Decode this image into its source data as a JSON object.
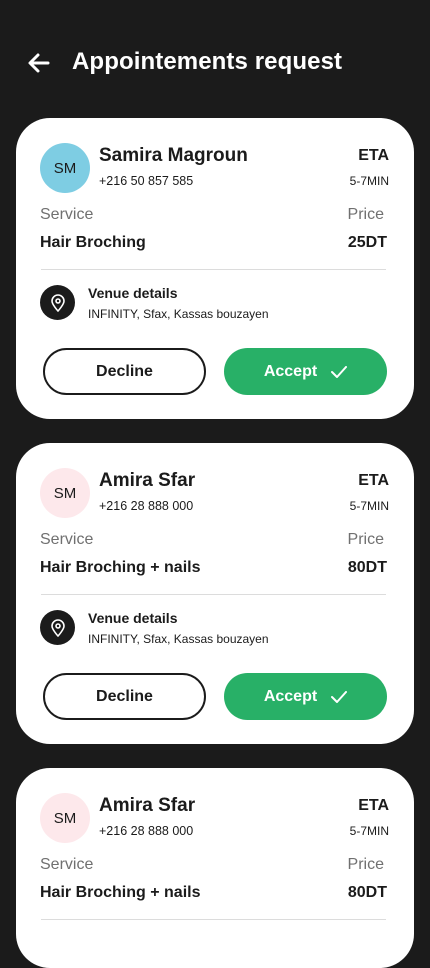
{
  "header": {
    "title": "Appointements request",
    "back_icon": "arrow-left-icon"
  },
  "colors": {
    "background": "#1b1b1b",
    "card": "#ffffff",
    "accept": "#28b067",
    "muted": "#707070"
  },
  "requests": [
    {
      "initials": "SM",
      "avatar_color": "#7ecde3",
      "name": "Samira Magroun",
      "phone": "+216 50 857 585",
      "eta_label": "ETA",
      "eta_value": "5-7MIN",
      "service_label": "Service",
      "service_value": "Hair Broching",
      "price_label": "Price",
      "price_value": "25DT",
      "venue_title": "Venue details",
      "venue_address": "INFINITY, Sfax, Kassas bouzayen",
      "decline_label": "Decline",
      "accept_label": "Accept"
    },
    {
      "initials": "SM",
      "avatar_color": "#fde8eb",
      "name": "Amira Sfar",
      "phone": "+216 28 888 000",
      "eta_label": "ETA",
      "eta_value": "5-7MIN",
      "service_label": "Service",
      "service_value": "Hair Broching + nails",
      "price_label": "Price",
      "price_value": "80DT",
      "venue_title": "Venue details",
      "venue_address": "INFINITY, Sfax, Kassas bouzayen",
      "decline_label": "Decline",
      "accept_label": "Accept"
    },
    {
      "initials": "SM",
      "avatar_color": "#fde8eb",
      "name": "Amira Sfar",
      "phone": "+216 28 888 000",
      "eta_label": "ETA",
      "eta_value": "5-7MIN",
      "service_label": "Service",
      "service_value": "Hair Broching + nails",
      "price_label": "Price",
      "price_value": "80DT"
    }
  ]
}
